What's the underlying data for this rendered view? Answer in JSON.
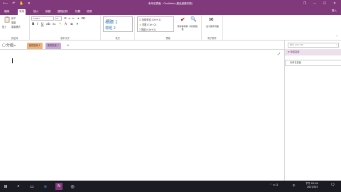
{
  "app": {
    "title": "未命名頁面 - OneNote (產品啟動失敗)",
    "sign_in": "登入"
  },
  "window_controls": {
    "restore": "❐",
    "minimize": "—",
    "maximize": "☐",
    "close": "✕"
  },
  "ribbon_tabs": [
    "檔案",
    "常用",
    "插入",
    "繪圖",
    "歷程記錄",
    "校閱",
    "檢視"
  ],
  "active_tab": "常用",
  "ribbon": {
    "clipboard": {
      "paste": "貼上",
      "cut": "剪下",
      "copy": "複製",
      "format_painter": "複製格式",
      "label": "剪貼簿"
    },
    "text": {
      "font": "Calibri",
      "size": "11",
      "label": "基本文字"
    },
    "styles": {
      "heading1": "標題 1",
      "heading2": "標題 2",
      "label": "樣式"
    },
    "tags": {
      "todo": "待辦事項 (Ctrl+1)",
      "important": "重要 (Ctrl+2)",
      "question": "問題 (Ctrl+3)",
      "label": "標籤"
    },
    "todo_tag": "待辦事項標籤",
    "find_tags": "尋找標籤",
    "email": {
      "email_page": "電子郵件頁面",
      "label": "電子郵件"
    }
  },
  "notebook": {
    "name": "分過",
    "sections": [
      "新的區段 1",
      "新的區段 2"
    ],
    "add_section": "+"
  },
  "side_pane": {
    "search_placeholder": "搜尋 (Ctrl+E)",
    "add_page": "新增頁面",
    "pages": [
      "未命名頁面"
    ]
  },
  "taskbar": {
    "time": "下午 01:34",
    "date": "2021/5/3",
    "lang": "中"
  },
  "colors": {
    "accent": "#80397b",
    "section1": "#f0b27a",
    "section2": "#c9a6d4"
  }
}
